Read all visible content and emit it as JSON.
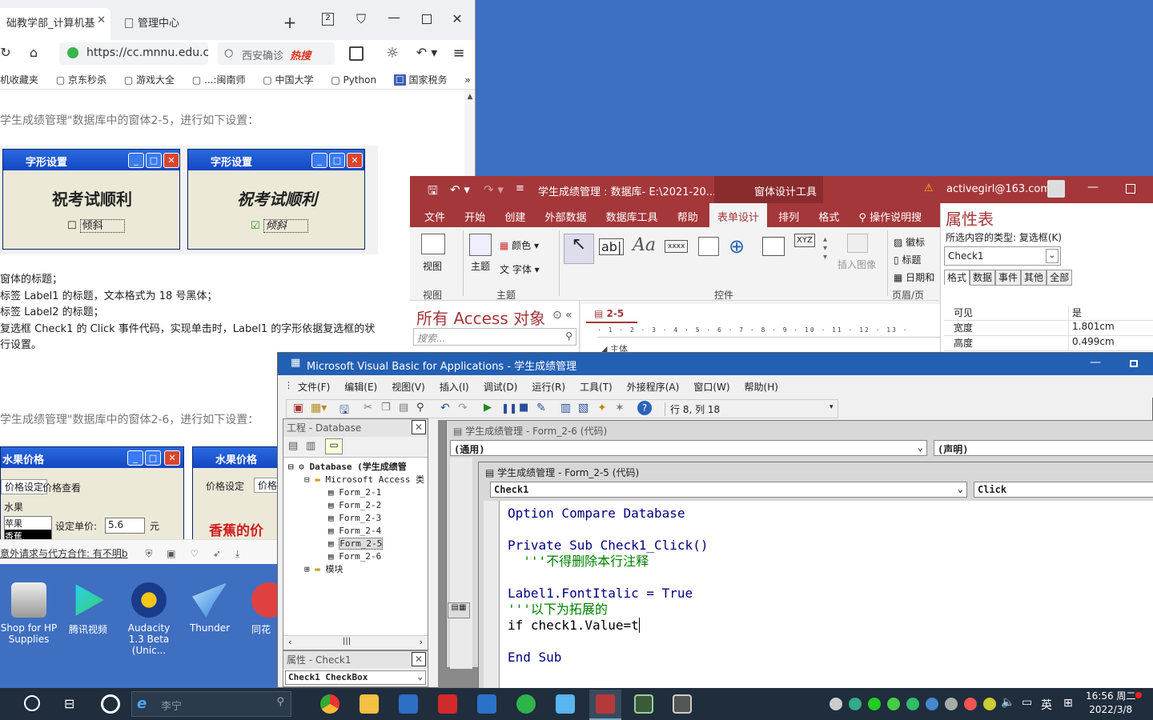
{
  "browser": {
    "tabs": [
      {
        "label": "础教学部_计算机基"
      },
      {
        "label": "管理中心"
      }
    ],
    "tab_count": "2",
    "url": "https://cc.mnnu.edu.c",
    "search_placeholder": "西安确诊",
    "hot_label": "热搜",
    "bookmarks": [
      "机收藏夹",
      "京东秒杀",
      "游戏大全",
      "...:闽南师",
      "中国大学",
      "Python",
      "国家税务"
    ],
    "bookmarks_more": "»",
    "content": {
      "line1": "学生成绩管理\"数据库中的窗体2-5，进行如下设置：",
      "window1_title": "字形设置",
      "window1_text": "祝考试顺利",
      "window1_check": "倾斜",
      "window2_title": "字形设置",
      "window2_text": "祝考试顺利",
      "window2_check": "倾斜",
      "items": [
        "窗体的标题；",
        "标签 Label1 的标题，文本格式为 18 号黑体；",
        "标签 Label2 的标题；",
        "复选框 Check1 的 Click 事件代码，实现单击时，Label1 的字形依据复选框的状",
        "行设置。"
      ],
      "line2": "学生成绩管理\"数据库中的窗体2-6，进行如下设置：",
      "fruit_title1": "水果价格",
      "fruit_title2": "水果价格",
      "fruit_tab1": "价格设定",
      "fruit_tab2": "价格查看",
      "fruit_label": "水果",
      "fruit_list": [
        "苹果",
        "香蕉"
      ],
      "fruit_price_label": "设定单价:",
      "fruit_price": "5.6",
      "fruit_unit": "元",
      "fruit_banner": "香蕉的价"
    },
    "status_text": "意外请求与代方合作: 有不明b"
  },
  "access": {
    "title": "学生成绩管理 : 数据库- E:\\2021-20...",
    "context_tab": "窗体设计工具",
    "account": "activegirl@163.com",
    "ribbon_tabs": [
      "文件",
      "开始",
      "创建",
      "外部数据",
      "数据库工具",
      "帮助",
      "表单设计",
      "排列",
      "格式"
    ],
    "tell_me": "操作说明搜",
    "groups": {
      "view": "视图",
      "view_btn": "视图",
      "theme": "主题",
      "theme_btn": "主题",
      "colors": "颜色",
      "fonts": "字体",
      "controls": "控件",
      "insert_image": "插入图像",
      "header_footer": "页眉/页",
      "logo": "徽标",
      "title_btn": "标题",
      "date": "日期和"
    },
    "nav_header": "所有 Access 对象",
    "nav_search": "搜索...",
    "form_tab": "2-5",
    "ruler_label": "主体",
    "property_sheet": {
      "title": "属性表",
      "selection_label": "所选内容的类型: 复选框(K)",
      "selected": "Check1",
      "tabs": [
        "格式",
        "数据",
        "事件",
        "其他",
        "全部"
      ],
      "rows": [
        {
          "name": "可见",
          "value": "是"
        },
        {
          "name": "宽度",
          "value": "1.801cm"
        },
        {
          "name": "高度",
          "value": "0.499cm"
        }
      ]
    }
  },
  "vba": {
    "title": "Microsoft Visual Basic for Applications - 学生成绩管理",
    "menu": [
      "文件(F)",
      "编辑(E)",
      "视图(V)",
      "插入(I)",
      "调试(D)",
      "运行(R)",
      "工具(T)",
      "外接程序(A)",
      "窗口(W)",
      "帮助(H)"
    ],
    "position": "行 8, 列 18",
    "project_title": "工程 - Database",
    "tree": {
      "root": "Database (学生成绩管",
      "folder": "Microsoft Access 类",
      "forms": [
        "Form_2-1",
        "Form_2-2",
        "Form_2-3",
        "Form_2-4",
        "Form_2-5",
        "Form_2-6"
      ],
      "modules": "模块"
    },
    "props_title": "属性 - Check1",
    "props_object": "Check1 CheckBox",
    "back_window": {
      "title": "学生成绩管理 - Form_2-6 (代码)",
      "object": "(通用)",
      "proc": "(声明)"
    },
    "front_window": {
      "title": "学生成绩管理 - Form_2-5 (代码)",
      "object": "Check1",
      "proc": "Click",
      "lines": [
        "Option Compare Database",
        "",
        "Private Sub Check1_Click()",
        "  '''不得删除本行注释",
        "",
        "Label1.FontItalic = True",
        "'''以下为拓展的",
        "if check1.Value=t",
        "",
        "End Sub"
      ]
    }
  },
  "desktop": {
    "icons": [
      {
        "label": "Shop for HP Supplies",
        "icon": "printer-icon"
      },
      {
        "label": "腾讯视频",
        "icon": "video-icon"
      },
      {
        "label": "Audacity 1.3 Beta (Unic...",
        "icon": "audio-icon"
      },
      {
        "label": "Thunder",
        "icon": "bird-icon"
      },
      {
        "label": "同花",
        "icon": "flower-icon"
      }
    ]
  },
  "taskbar": {
    "search_placeholder": "李宁",
    "time": "16:56 周二",
    "date": "2022/3/8",
    "ime": "英"
  }
}
